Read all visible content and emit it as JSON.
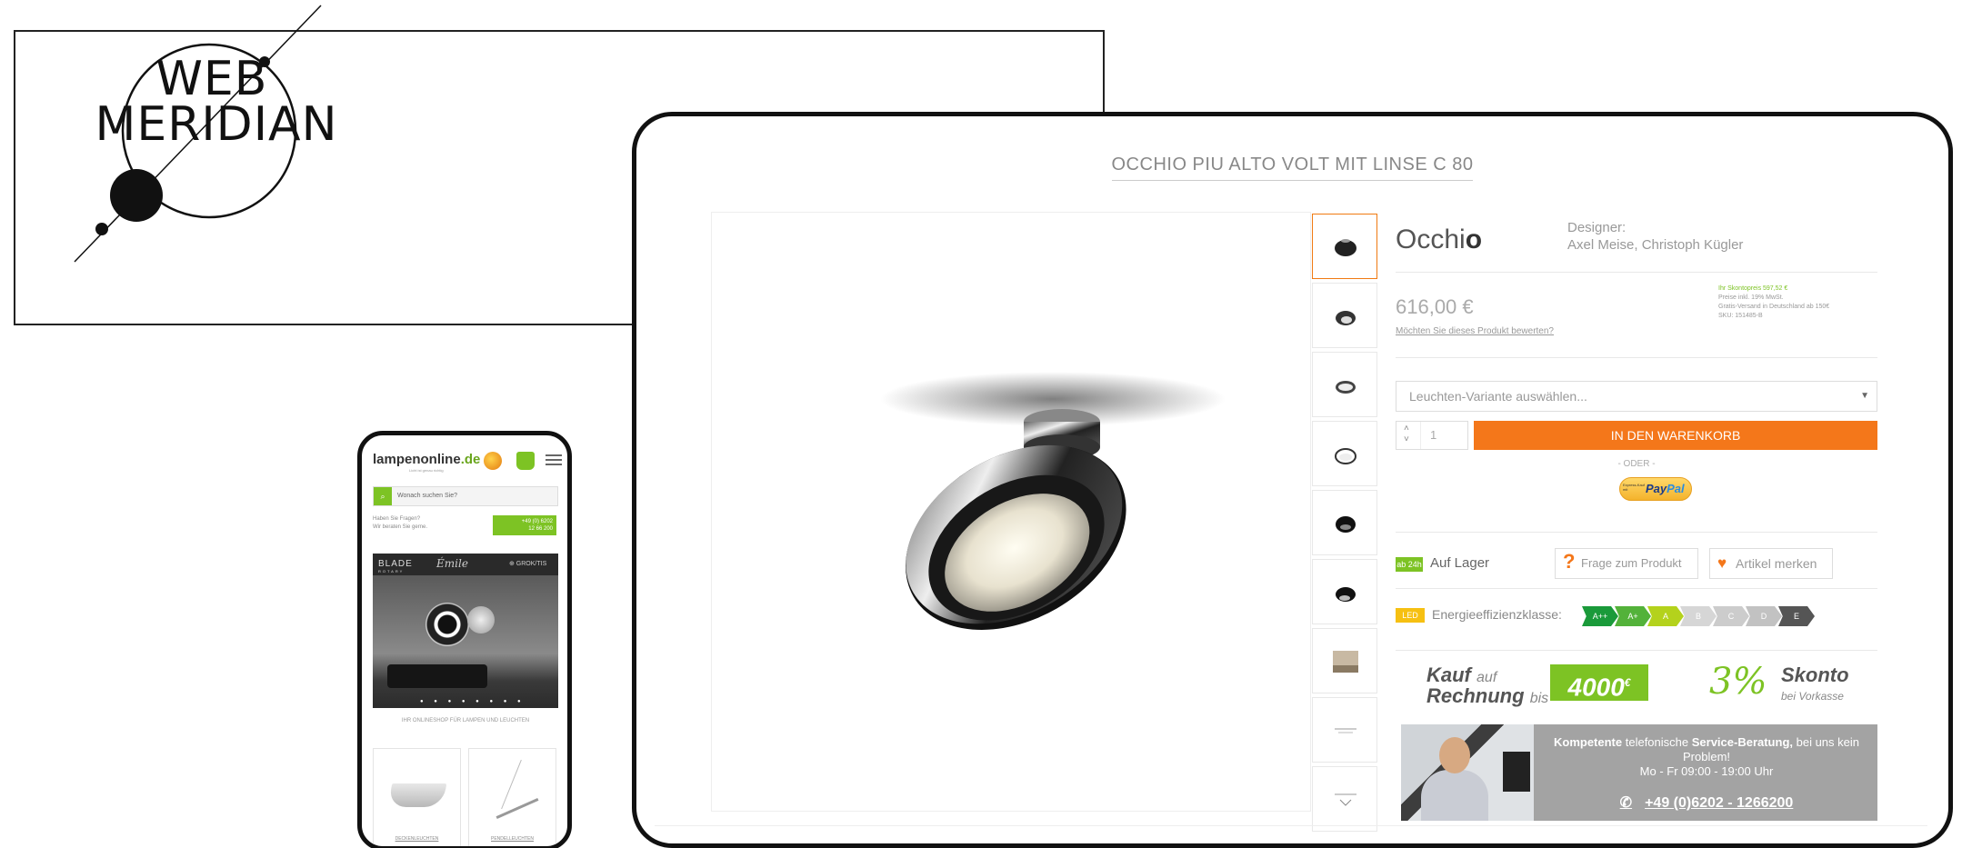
{
  "logo": {
    "line1": "WEB",
    "line2": "MERIDIAN"
  },
  "phone": {
    "shop_logo": "lampenonline",
    "shop_logo_tld": ".de",
    "shop_logo_sub": "Licht ist genau richtig",
    "search_placeholder": "Wonach suchen Sie?",
    "question_text_1": "Haben Sie Fragen?",
    "question_text_2": "Wir beraten Sie gerne.",
    "phone_button_1": "+49 (0) 6202",
    "phone_button_2": "12 66 200",
    "banner_brand": "BLADE",
    "banner_brand_sub": "ROTARY",
    "banner_script": "Émile",
    "banner_right": "⊕ GROK/TIS",
    "caption": "IHR ONLINESHOP FÜR LAMPEN UND LEUCHTEN",
    "card_1_label": "DECKENLEUCHTEN",
    "card_2_label": "PENDELLEUCHTEN"
  },
  "product": {
    "title": "OCCHIO PIU ALTO VOLT MIT LINSE C 80",
    "brand_light": "Occhi",
    "brand_bold": "o",
    "designer_label": "Designer:",
    "designer_names": "Axel Meise, Christoph Kügler",
    "price": "616,00 €",
    "rate_link": "Möchten Sie dieses Produkt bewerten?",
    "skonto_line": "Ihr Skontopreis 597,52 €",
    "tax_line": "Preise inkl. 19% MwSt.",
    "shipping_line": "Gratis-Versand in Deutschland ab 150€",
    "sku_line": "SKU: 151485-B",
    "variant_placeholder": "Leuchten-Variante auswählen...",
    "quantity": "1",
    "cart_button": "IN DEN WARENKORB",
    "or_text": "- ODER -",
    "paypal_small_1": "Express-Kauf",
    "paypal_small_2": "mit",
    "paypal_pay": "Pay",
    "paypal_pal": "Pal",
    "stock_badge": "ab 24h",
    "stock_text": "Auf Lager",
    "ask_button": "Frage zum Produkt",
    "fav_button": "Artikel merken",
    "led_badge": "LED",
    "energy_label": "Energieeffizienzklasse:",
    "energy_classes": [
      "A++",
      "A+",
      "A",
      "B",
      "C",
      "D",
      "E"
    ],
    "energy_colors": [
      "#1a9a3a",
      "#53b23a",
      "#b4d21c",
      "#d6d6d6",
      "#cccccc",
      "#c2c2c2",
      "#555555"
    ],
    "kauf_1": "Kauf",
    "kauf_2": "auf",
    "kauf_3": "Rechnung",
    "kauf_4": "bis",
    "amount": "4000",
    "amount_currency": "€",
    "skonto_pct": "3%",
    "skonto_word": "Skonto",
    "skonto_sub": "bei Vorkasse",
    "service_bold_1": "Kompetente",
    "service_text_1": " telefonische ",
    "service_bold_2": "Service-Beratung,",
    "service_text_2": " bei uns kein Problem!",
    "service_hours": "Mo - Fr 09:00 - 19:00 Uhr",
    "service_phone": "+49 (0)6202 - 1266200"
  },
  "colors": {
    "accent_orange": "#f4771a",
    "accent_green": "#7dc324"
  }
}
